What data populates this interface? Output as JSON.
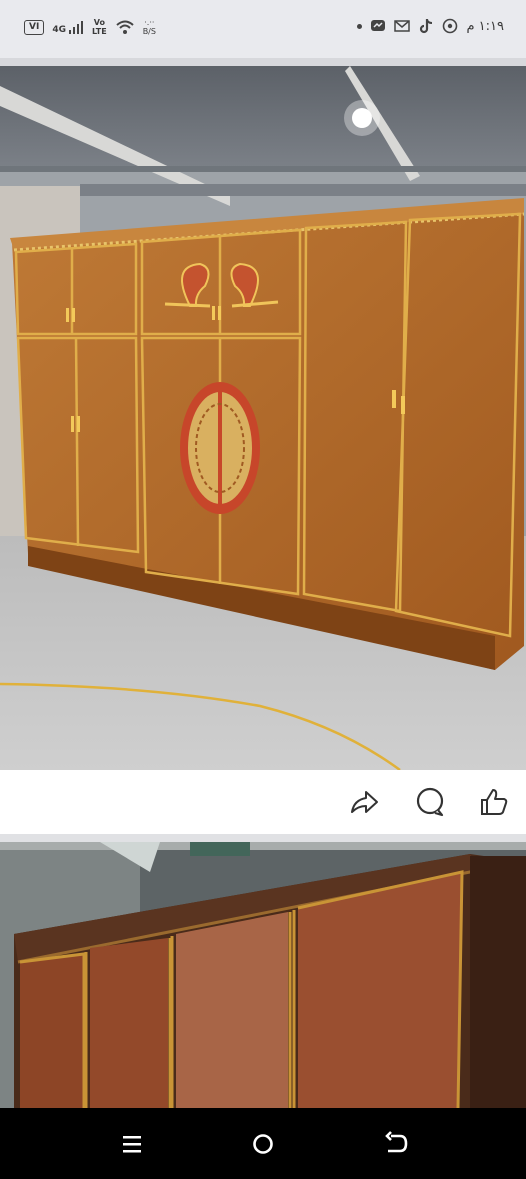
{
  "status_bar": {
    "sim_label": "VI",
    "network_label": "4G",
    "volte_top": "Vo",
    "volte_bottom": "LTE",
    "speed_top": "·.··",
    "speed_bottom": "B/S",
    "time": "١:١٩ م",
    "icons": [
      "signal-icon",
      "wifi-icon",
      "messenger-icon",
      "gmail-icon",
      "tiktok-icon",
      "whatsapp-icon"
    ]
  },
  "post_actions": {
    "items": [
      "share-icon",
      "comment-icon",
      "like-icon"
    ]
  },
  "navigation": {
    "items": [
      "recents-icon",
      "home-icon",
      "back-icon"
    ]
  },
  "colors": {
    "status_bg": "#e9eaee",
    "wood": "#b06a2c",
    "wood_dark": "#8a4a1a",
    "trim": "#d9a441",
    "nav_bg": "#000000"
  }
}
